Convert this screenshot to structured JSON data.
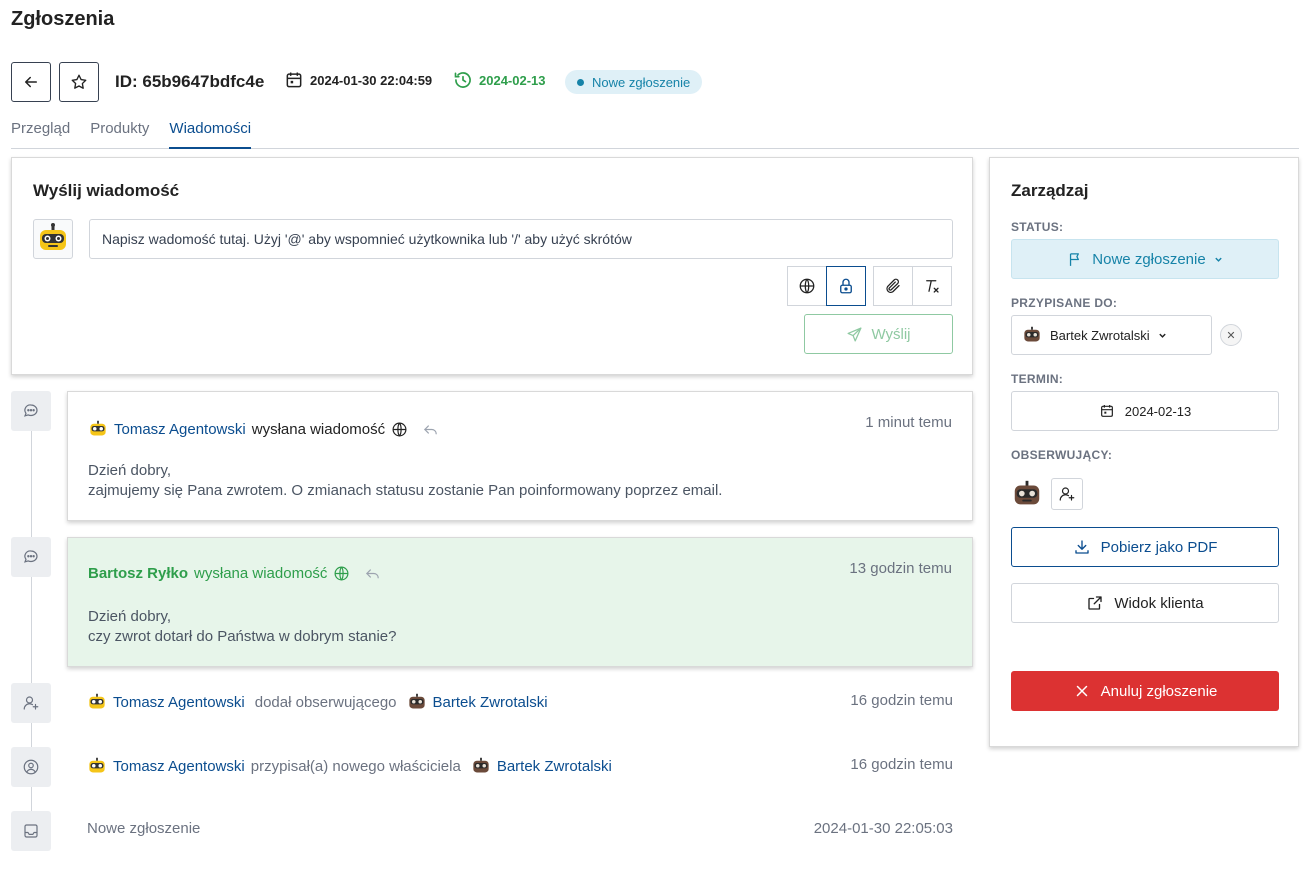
{
  "page": {
    "title": "Zgłoszenia"
  },
  "header": {
    "id_label": "ID: 65b9647bdfc4e",
    "created": "2024-01-30 22:04:59",
    "due": "2024-02-13",
    "status_badge": "Nowe zgłoszenie"
  },
  "tabs": [
    {
      "label": "Przegląd",
      "active": false
    },
    {
      "label": "Produkty",
      "active": false
    },
    {
      "label": "Wiadomości",
      "active": true
    }
  ],
  "compose": {
    "title": "Wyślij wiadomość",
    "placeholder": "Napisz wadomość tutaj. Użyj '@' aby wspomnieć użytkownika lub '/' aby użyć skrótów",
    "send_label": "Wyślij"
  },
  "timeline": {
    "messages": [
      {
        "author": "Tomasz Agentowski",
        "action": "wysłana wiadomość",
        "time": "1 minut temu",
        "line1": "Dzień dobry,",
        "line2": "zajmujemy się Pana zwrotem. O zmianach statusu zostanie Pan poinformowany poprzez email."
      },
      {
        "author": "Bartosz Ryłko",
        "action": "wysłana wiadomość",
        "time": "13 godzin temu",
        "line1": "Dzień dobry,",
        "line2": "czy zwrot dotarł do Państwa w dobrym stanie?"
      }
    ],
    "events": [
      {
        "actor": "Tomasz Agentowski",
        "action": "dodał obserwującego",
        "target": "Bartek Zwrotalski",
        "time": "16 godzin temu"
      },
      {
        "actor": "Tomasz Agentowski",
        "action": "przypisał(a) nowego właściciela",
        "target": "Bartek Zwrotalski",
        "time": "16 godzin temu"
      },
      {
        "text": "Nowe zgłoszenie",
        "time": "2024-01-30 22:05:03"
      }
    ]
  },
  "manage": {
    "title": "Zarządzaj",
    "status_label": "STATUS:",
    "status_value": "Nowe zgłoszenie",
    "assigned_label": "PRZYPISANE DO:",
    "assigned_value": "Bartek Zwrotalski",
    "term_label": "TERMIN:",
    "term_value": "2024-02-13",
    "observers_label": "OBSERWUJĄCY:",
    "pdf_label": "Pobierz jako PDF",
    "client_label": "Widok klienta",
    "cancel_label": "Anuluj zgłoszenie"
  },
  "colors": {
    "accent": "#0b4d8f",
    "success": "#2e9e4b",
    "info": "#1683a8",
    "danger": "#dc3232"
  }
}
